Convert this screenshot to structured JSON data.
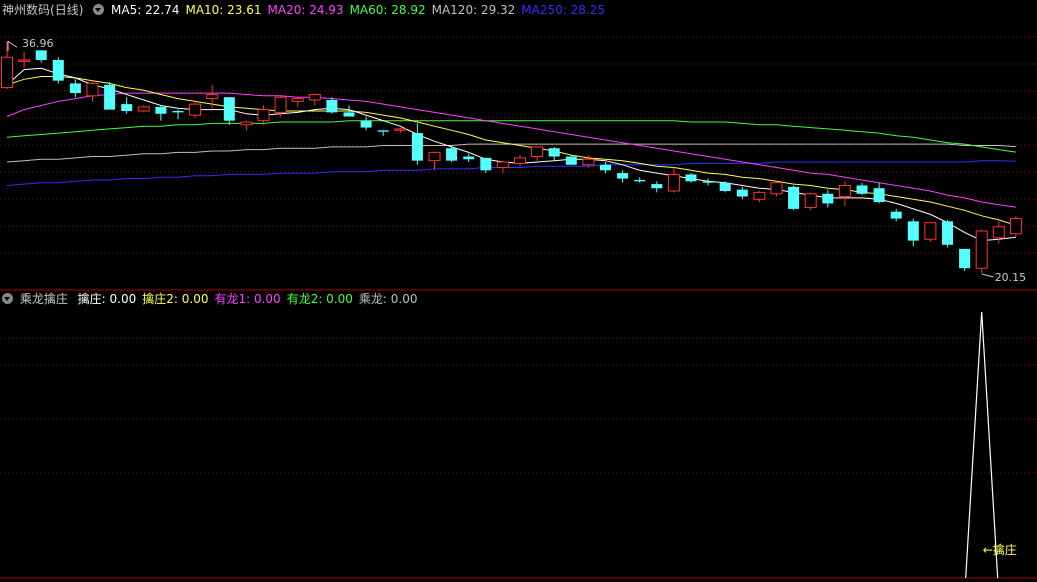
{
  "main_panel": {
    "stock_name": "神州数码",
    "period": "(日线)",
    "ma_labels": [
      {
        "text": "MA5: 22.74",
        "color": "#ffffff"
      },
      {
        "text": "MA10: 23.61",
        "color": "#ffff4f"
      },
      {
        "text": "MA20: 24.93",
        "color": "#ff40ff"
      },
      {
        "text": "MA60: 28.92",
        "color": "#40ff40"
      },
      {
        "text": "MA120: 29.32",
        "color": "#c0c0c0"
      },
      {
        "text": "MA250: 28.25",
        "color": "#3030ff"
      }
    ],
    "high_label": "36.96",
    "low_label": "20.15"
  },
  "indicator_panel": {
    "name": "乘龙擒庄",
    "labels": [
      {
        "text": "擒庄: 0.00",
        "color": "#ffffff"
      },
      {
        "text": "擒庄2: 0.00",
        "color": "#ffff4f"
      },
      {
        "text": "有龙1: 0.00",
        "color": "#ff40ff"
      },
      {
        "text": "有龙2: 0.00",
        "color": "#40ff40"
      },
      {
        "text": "乘龙: 0.00",
        "color": "#c0c0c0"
      }
    ],
    "annotation": "←擒庄"
  },
  "colors": {
    "background": "#000000",
    "grid": "#8b0000",
    "up_candle": "#ff3232",
    "down_candle": "#54ffff",
    "ma5": "#ffffff",
    "ma10": "#ffff4f",
    "ma20": "#ff40ff",
    "ma60": "#40ff40",
    "ma120": "#c0c0c0",
    "ma250": "#3030ff"
  },
  "chart_data": {
    "type": "candlestick",
    "price_range": [
      19.5,
      38.5
    ],
    "ohlc": [
      [
        33.6,
        36.96,
        33.5,
        35.8
      ],
      [
        35.5,
        36.2,
        35.0,
        35.6
      ],
      [
        36.3,
        36.3,
        35.4,
        35.6
      ],
      [
        35.6,
        35.8,
        33.9,
        34.1
      ],
      [
        33.9,
        34.2,
        32.9,
        33.2
      ],
      [
        33.0,
        34.1,
        32.6,
        33.9
      ],
      [
        33.8,
        34.0,
        32.6,
        32.0
      ],
      [
        32.4,
        32.9,
        31.7,
        31.9
      ],
      [
        31.9,
        32.3,
        31.8,
        32.2
      ],
      [
        32.2,
        32.3,
        31.2,
        31.7
      ],
      [
        31.9,
        32.0,
        31.3,
        31.8
      ],
      [
        31.6,
        32.7,
        31.4,
        32.4
      ],
      [
        32.8,
        33.8,
        32.1,
        33.1
      ],
      [
        32.9,
        32.9,
        30.9,
        31.2
      ],
      [
        30.9,
        31.2,
        30.5,
        31.1
      ],
      [
        31.2,
        32.3,
        30.9,
        32.0
      ],
      [
        31.8,
        33.0,
        31.5,
        32.9
      ],
      [
        32.6,
        32.9,
        32.2,
        32.8
      ],
      [
        32.7,
        33.0,
        32.3,
        33.1
      ],
      [
        32.7,
        32.9,
        31.7,
        31.8
      ],
      [
        31.8,
        32.3,
        31.5,
        31.5
      ],
      [
        31.2,
        31.5,
        30.5,
        30.7
      ],
      [
        30.5,
        30.5,
        30.1,
        30.4
      ],
      [
        30.5,
        30.7,
        30.3,
        30.6
      ],
      [
        30.3,
        31.0,
        28.0,
        28.3
      ],
      [
        28.3,
        28.7,
        27.6,
        28.9
      ],
      [
        29.2,
        29.4,
        28.2,
        28.3
      ],
      [
        28.6,
        28.8,
        28.2,
        28.4
      ],
      [
        28.5,
        28.5,
        27.4,
        27.6
      ],
      [
        27.8,
        28.3,
        27.4,
        28.2
      ],
      [
        28.1,
        28.7,
        27.9,
        28.5
      ],
      [
        28.6,
        29.2,
        28.3,
        29.3
      ],
      [
        29.2,
        29.3,
        28.3,
        28.6
      ],
      [
        28.6,
        28.7,
        28.0,
        28.0
      ],
      [
        28.0,
        28.7,
        27.8,
        28.4
      ],
      [
        28.0,
        28.2,
        27.4,
        27.6
      ],
      [
        27.4,
        27.6,
        26.7,
        27.0
      ],
      [
        26.9,
        27.1,
        26.7,
        26.8
      ],
      [
        26.6,
        26.8,
        26.0,
        26.3
      ],
      [
        26.1,
        27.8,
        26.0,
        27.3
      ],
      [
        27.3,
        27.4,
        26.7,
        26.8
      ],
      [
        26.8,
        27.0,
        26.5,
        26.7
      ],
      [
        26.7,
        26.8,
        26.0,
        26.1
      ],
      [
        26.2,
        26.4,
        25.5,
        25.7
      ],
      [
        25.5,
        26.1,
        25.3,
        26.0
      ],
      [
        25.9,
        26.8,
        25.7,
        26.7
      ],
      [
        26.4,
        26.5,
        24.7,
        24.8
      ],
      [
        24.9,
        26.0,
        24.7,
        25.9
      ],
      [
        25.9,
        26.2,
        24.9,
        25.2
      ],
      [
        25.7,
        26.8,
        25.0,
        26.5
      ],
      [
        26.5,
        26.7,
        25.8,
        25.9
      ],
      [
        26.3,
        26.7,
        25.2,
        25.3
      ],
      [
        24.6,
        24.8,
        23.9,
        24.1
      ],
      [
        23.9,
        24.1,
        22.1,
        22.5
      ],
      [
        22.6,
        23.8,
        22.4,
        23.8
      ],
      [
        23.9,
        24.0,
        22.0,
        22.2
      ],
      [
        21.9,
        21.9,
        20.3,
        20.5
      ],
      [
        20.5,
        23.3,
        20.15,
        23.2
      ],
      [
        22.7,
        23.9,
        22.3,
        23.5
      ],
      [
        23.0,
        24.3,
        22.8,
        24.1
      ]
    ],
    "ma": {
      "ma5": [
        33.8,
        34.9,
        35.0,
        34.6,
        34.3,
        33.8,
        33.5,
        33.1,
        32.7,
        32.3,
        32.1,
        32.0,
        32.0,
        32.0,
        31.7,
        31.6,
        31.7,
        31.8,
        32.0,
        32.1,
        32.0,
        31.6,
        31.2,
        30.8,
        30.2,
        29.7,
        29.3,
        28.9,
        28.4,
        28.2,
        28.1,
        28.2,
        28.3,
        28.4,
        28.4,
        28.3,
        28.0,
        27.6,
        27.4,
        27.2,
        27.0,
        26.8,
        26.7,
        26.5,
        26.3,
        26.2,
        26.0,
        25.8,
        25.6,
        25.6,
        25.6,
        25.5,
        25.2,
        24.8,
        24.4,
        23.8,
        23.1,
        22.5,
        22.6,
        22.74
      ],
      "ma10": [
        33.8,
        34.2,
        34.4,
        34.4,
        34.3,
        34.1,
        33.9,
        33.6,
        33.4,
        33.1,
        32.8,
        32.6,
        32.4,
        32.2,
        32.1,
        32.0,
        31.9,
        31.9,
        31.9,
        31.9,
        31.9,
        31.8,
        31.6,
        31.4,
        31.1,
        30.8,
        30.5,
        30.2,
        29.8,
        29.6,
        29.4,
        29.2,
        29.0,
        28.7,
        28.5,
        28.4,
        28.3,
        28.1,
        27.9,
        27.8,
        27.6,
        27.4,
        27.3,
        27.1,
        27.0,
        26.8,
        26.6,
        26.5,
        26.3,
        26.2,
        26.0,
        25.9,
        25.7,
        25.5,
        25.3,
        25.0,
        24.7,
        24.3,
        24.0,
        23.61
      ],
      "ma20": [
        31.5,
        32.0,
        32.3,
        32.6,
        32.8,
        33.0,
        33.1,
        33.2,
        33.2,
        33.2,
        33.2,
        33.2,
        33.2,
        33.2,
        33.1,
        33.0,
        33.0,
        32.9,
        32.9,
        32.8,
        32.7,
        32.6,
        32.4,
        32.2,
        32.0,
        31.8,
        31.6,
        31.4,
        31.2,
        31.0,
        30.8,
        30.6,
        30.4,
        30.2,
        30.0,
        29.8,
        29.6,
        29.4,
        29.2,
        29.0,
        28.8,
        28.6,
        28.4,
        28.2,
        28.0,
        27.8,
        27.6,
        27.4,
        27.3,
        27.1,
        26.9,
        26.7,
        26.5,
        26.3,
        26.1,
        25.8,
        25.6,
        25.3,
        25.1,
        24.93
      ],
      "ma60": [
        30.0,
        30.1,
        30.2,
        30.3,
        30.4,
        30.5,
        30.6,
        30.7,
        30.8,
        30.8,
        30.9,
        30.9,
        31.0,
        31.0,
        31.0,
        31.0,
        31.1,
        31.1,
        31.1,
        31.1,
        31.2,
        31.2,
        31.2,
        31.2,
        31.2,
        31.2,
        31.2,
        31.2,
        31.2,
        31.2,
        31.2,
        31.2,
        31.2,
        31.2,
        31.2,
        31.2,
        31.2,
        31.2,
        31.2,
        31.2,
        31.1,
        31.1,
        31.1,
        31.0,
        30.9,
        30.9,
        30.8,
        30.7,
        30.6,
        30.5,
        30.4,
        30.3,
        30.1,
        30.0,
        29.8,
        29.6,
        29.5,
        29.3,
        29.1,
        28.92
      ],
      "ma120": [
        28.2,
        28.3,
        28.4,
        28.4,
        28.5,
        28.6,
        28.6,
        28.7,
        28.8,
        28.8,
        28.9,
        28.9,
        29.0,
        29.0,
        29.1,
        29.1,
        29.2,
        29.2,
        29.2,
        29.3,
        29.3,
        29.3,
        29.4,
        29.4,
        29.4,
        29.4,
        29.4,
        29.5,
        29.5,
        29.5,
        29.5,
        29.5,
        29.5,
        29.5,
        29.5,
        29.5,
        29.5,
        29.5,
        29.5,
        29.5,
        29.5,
        29.5,
        29.5,
        29.5,
        29.5,
        29.5,
        29.5,
        29.5,
        29.5,
        29.5,
        29.5,
        29.5,
        29.5,
        29.5,
        29.5,
        29.5,
        29.4,
        29.4,
        29.4,
        29.32
      ],
      "ma250": [
        26.5,
        26.6,
        26.7,
        26.7,
        26.8,
        26.9,
        26.9,
        27.0,
        27.0,
        27.1,
        27.1,
        27.2,
        27.2,
        27.3,
        27.3,
        27.3,
        27.4,
        27.4,
        27.4,
        27.5,
        27.5,
        27.5,
        27.6,
        27.6,
        27.6,
        27.7,
        27.7,
        27.7,
        27.8,
        27.8,
        27.8,
        27.9,
        27.9,
        27.9,
        27.9,
        28.0,
        28.0,
        28.0,
        28.0,
        28.0,
        28.1,
        28.1,
        28.1,
        28.1,
        28.1,
        28.2,
        28.2,
        28.2,
        28.2,
        28.2,
        28.2,
        28.2,
        28.2,
        28.2,
        28.2,
        28.2,
        28.2,
        28.3,
        28.3,
        28.25
      ]
    },
    "indicator": {
      "type": "line",
      "signal_index": 57,
      "values_note_free": true,
      "series": [
        {
          "values": [
            0,
            0,
            0,
            0,
            0,
            0,
            0,
            0,
            0,
            0,
            0,
            0,
            0,
            0,
            0,
            0,
            0,
            0,
            0,
            0,
            0,
            0,
            0,
            0,
            0,
            0,
            0,
            0,
            0,
            0,
            0,
            0,
            0,
            0,
            0,
            0,
            0,
            0,
            0,
            0,
            0,
            0,
            0,
            0,
            0,
            0,
            0,
            0,
            0,
            0,
            0,
            0,
            0,
            0,
            0,
            0,
            0,
            1,
            0,
            0
          ]
        }
      ]
    }
  }
}
